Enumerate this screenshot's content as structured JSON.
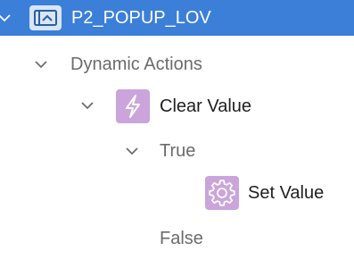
{
  "tree": {
    "item": {
      "label": "P2_POPUP_LOV",
      "icon": "popup-lov-item-icon",
      "selected": true,
      "highlight_color": "#3b7fd9"
    },
    "dynamic_actions": {
      "label": "Dynamic Actions",
      "expanded": true
    },
    "event": {
      "label": "Clear Value",
      "icon": "lightning-bolt-icon",
      "icon_color": "#cba4dc",
      "expanded": true
    },
    "true_branch": {
      "label": "True",
      "expanded": true
    },
    "action": {
      "label": "Set Value",
      "icon": "gear-icon",
      "icon_color": "#cba4dc"
    },
    "false_branch": {
      "label": "False"
    }
  }
}
